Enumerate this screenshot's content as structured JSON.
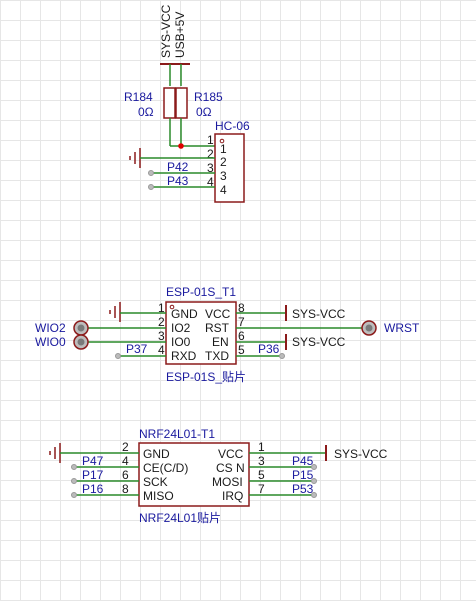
{
  "top": {
    "net_vcc": "SYS-VCC",
    "net_usb": "USB+5V",
    "r184": {
      "ref": "R184",
      "value": "0Ω"
    },
    "r185": {
      "ref": "R185",
      "value": "0Ω"
    },
    "hc06": {
      "ref": "HC-06",
      "pins": [
        "1",
        "2",
        "3",
        "4"
      ],
      "nets": [
        "P42",
        "P43"
      ]
    }
  },
  "esp": {
    "ref": "ESP-01S_T1",
    "footprint": "ESP-01S_贴片",
    "left_nums": [
      "1",
      "2",
      "3",
      "4"
    ],
    "left_pins": [
      "GND",
      "IO2",
      "IO0",
      "RXD"
    ],
    "right_nums": [
      "8",
      "7",
      "6",
      "5"
    ],
    "right_pins": [
      "VCC",
      "RST",
      "EN",
      "TXD"
    ],
    "ext": {
      "wio2": "WIO2",
      "wio0": "WIO0",
      "wrst": "WRST",
      "vcc1": "SYS-VCC",
      "vcc2": "SYS-VCC",
      "p37": "P37",
      "p36": "P36"
    }
  },
  "nrf": {
    "ref": "NRF24L01-T1",
    "footprint": "NRF24L01贴片",
    "left_nums": [
      "2",
      "4",
      "6",
      "8"
    ],
    "left_pins": [
      "GND",
      "CE(C/D)",
      "SCK",
      "MISO"
    ],
    "left_nets": [
      "P47",
      "P17",
      "P16"
    ],
    "right_nums": [
      "1",
      "3",
      "5",
      "7"
    ],
    "right_pins": [
      "VCC",
      "CS N",
      "MOSI",
      "IRQ"
    ],
    "right_nets": [
      "P45",
      "P15",
      "P53"
    ],
    "vcc": "SYS-VCC"
  },
  "colors": {
    "wire": "#2a8a2a",
    "body": "#8b1a1a",
    "label": "#1a1a9e",
    "junction": "#e00000"
  }
}
